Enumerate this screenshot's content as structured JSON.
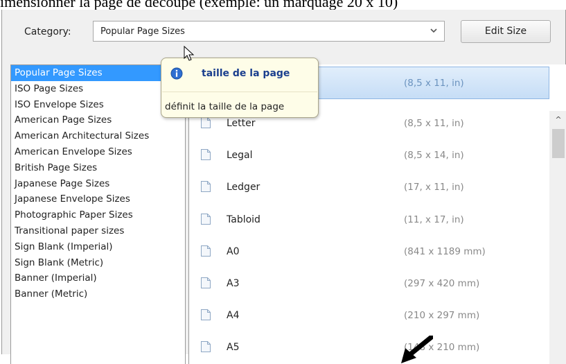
{
  "top_caption": "imensionner la page de découpe (exemple: un marquage 20 x 10)",
  "category": {
    "label": "Category:",
    "selected_value": "Popular Page Sizes",
    "edit_button": "Edit Size"
  },
  "tooltip": {
    "title": "taille de la page",
    "text": "définit la taille de la page"
  },
  "category_list": [
    "Popular Page Sizes",
    "ISO Page Sizes",
    "ISO Envelope Sizes",
    "American Page Sizes",
    "American Architectural Sizes",
    "American Envelope Sizes",
    "British Page Sizes",
    "Japanese Page Sizes",
    "Japanese Envelope Sizes",
    "Photographic Paper Sizes",
    "Transitional paper sizes",
    "Sign Blank (Imperial)",
    "Sign Blank (Metric)",
    "Banner (Imperial)",
    "Banner (Metric)"
  ],
  "selected_size": {
    "dimensions": "(8,5 x 11, in)"
  },
  "sizes": [
    {
      "name": "Letter",
      "dimensions": "(8,5 x 11, in)"
    },
    {
      "name": "Legal",
      "dimensions": "(8,5 x 14, in)"
    },
    {
      "name": "Ledger",
      "dimensions": "(17, x 11, in)"
    },
    {
      "name": "Tabloid",
      "dimensions": "(11, x 17, in)"
    },
    {
      "name": "A0",
      "dimensions": "(841 x 1189 mm)"
    },
    {
      "name": "A3",
      "dimensions": "(297 x 420 mm)"
    },
    {
      "name": "A4",
      "dimensions": "(210 x 297 mm)"
    },
    {
      "name": "A5",
      "dimensions": "(148 x 210 mm)"
    }
  ],
  "icons": {
    "info": "info-icon",
    "document": "document-icon",
    "chevron": "chevron-down-icon",
    "cursor": "mouse-cursor-icon",
    "arrow": "annotation-arrow-icon"
  },
  "colors": {
    "selection_blue": "#3399ff",
    "tooltip_bg": "#fefde8",
    "tooltip_title": "#1b3f8e"
  }
}
